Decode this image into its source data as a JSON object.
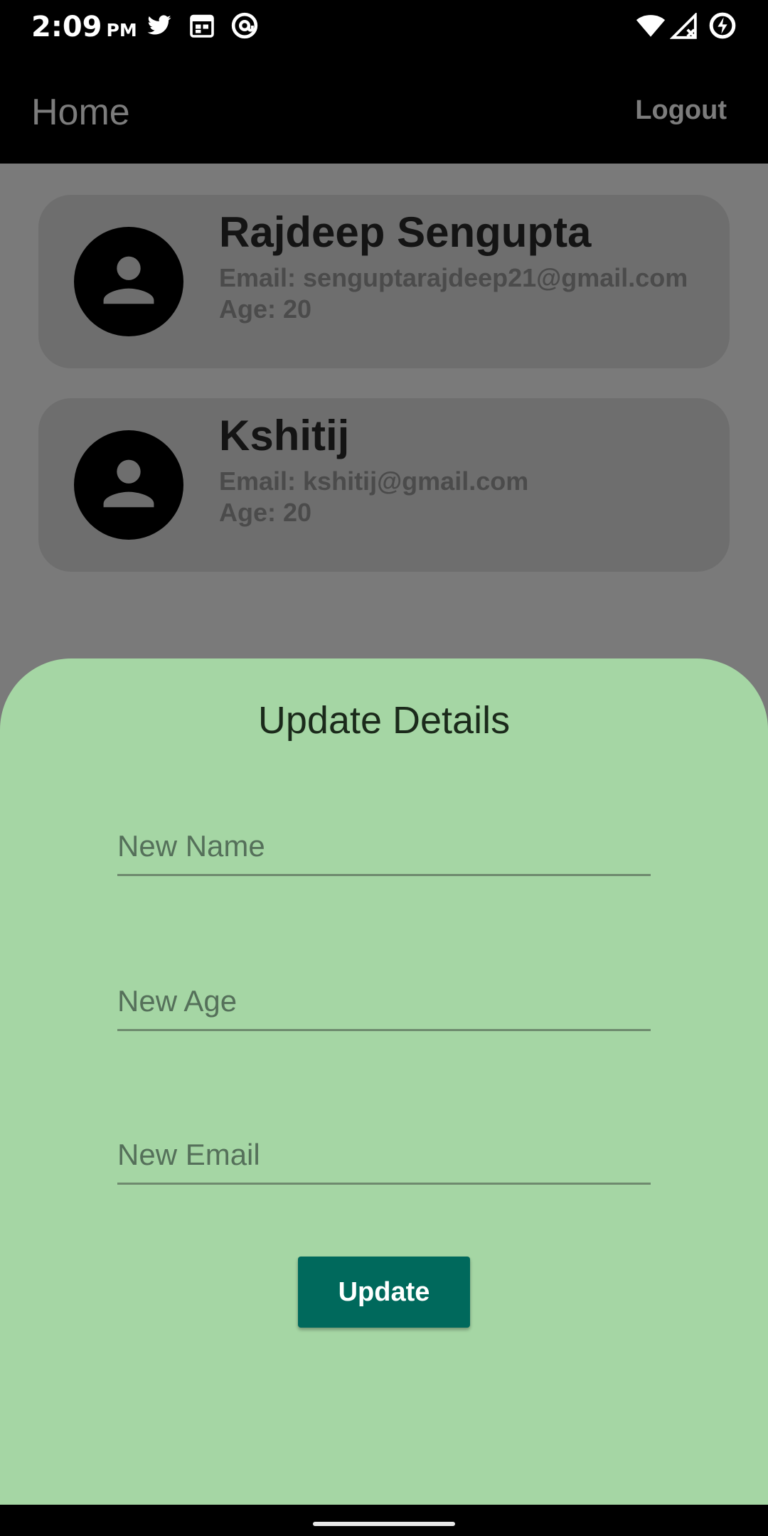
{
  "status_bar": {
    "time": "2:09",
    "ampm": "PM",
    "left_icons": [
      "twitter-icon",
      "calendar-icon",
      "at-sign-icon"
    ],
    "right_icons": [
      "wifi-icon",
      "cell-signal-icon",
      "battery-saver-icon"
    ]
  },
  "app_bar": {
    "title": "Home",
    "logout_label": "Logout"
  },
  "users": [
    {
      "name": "Rajdeep Sengupta",
      "email": "Email: senguptarajdeep21@gmail.com",
      "age": "Age: 20"
    },
    {
      "name": "Kshitij",
      "email": "Email: kshitij@gmail.com",
      "age": "Age: 20"
    }
  ],
  "sheet": {
    "title": "Update Details",
    "name_placeholder": "New Name",
    "age_placeholder": "New Age",
    "email_placeholder": "New Email",
    "update_label": "Update"
  },
  "colors": {
    "sheet_background": "#a5d6a4",
    "button": "#00695c",
    "scrim": "#7a7a7a"
  }
}
